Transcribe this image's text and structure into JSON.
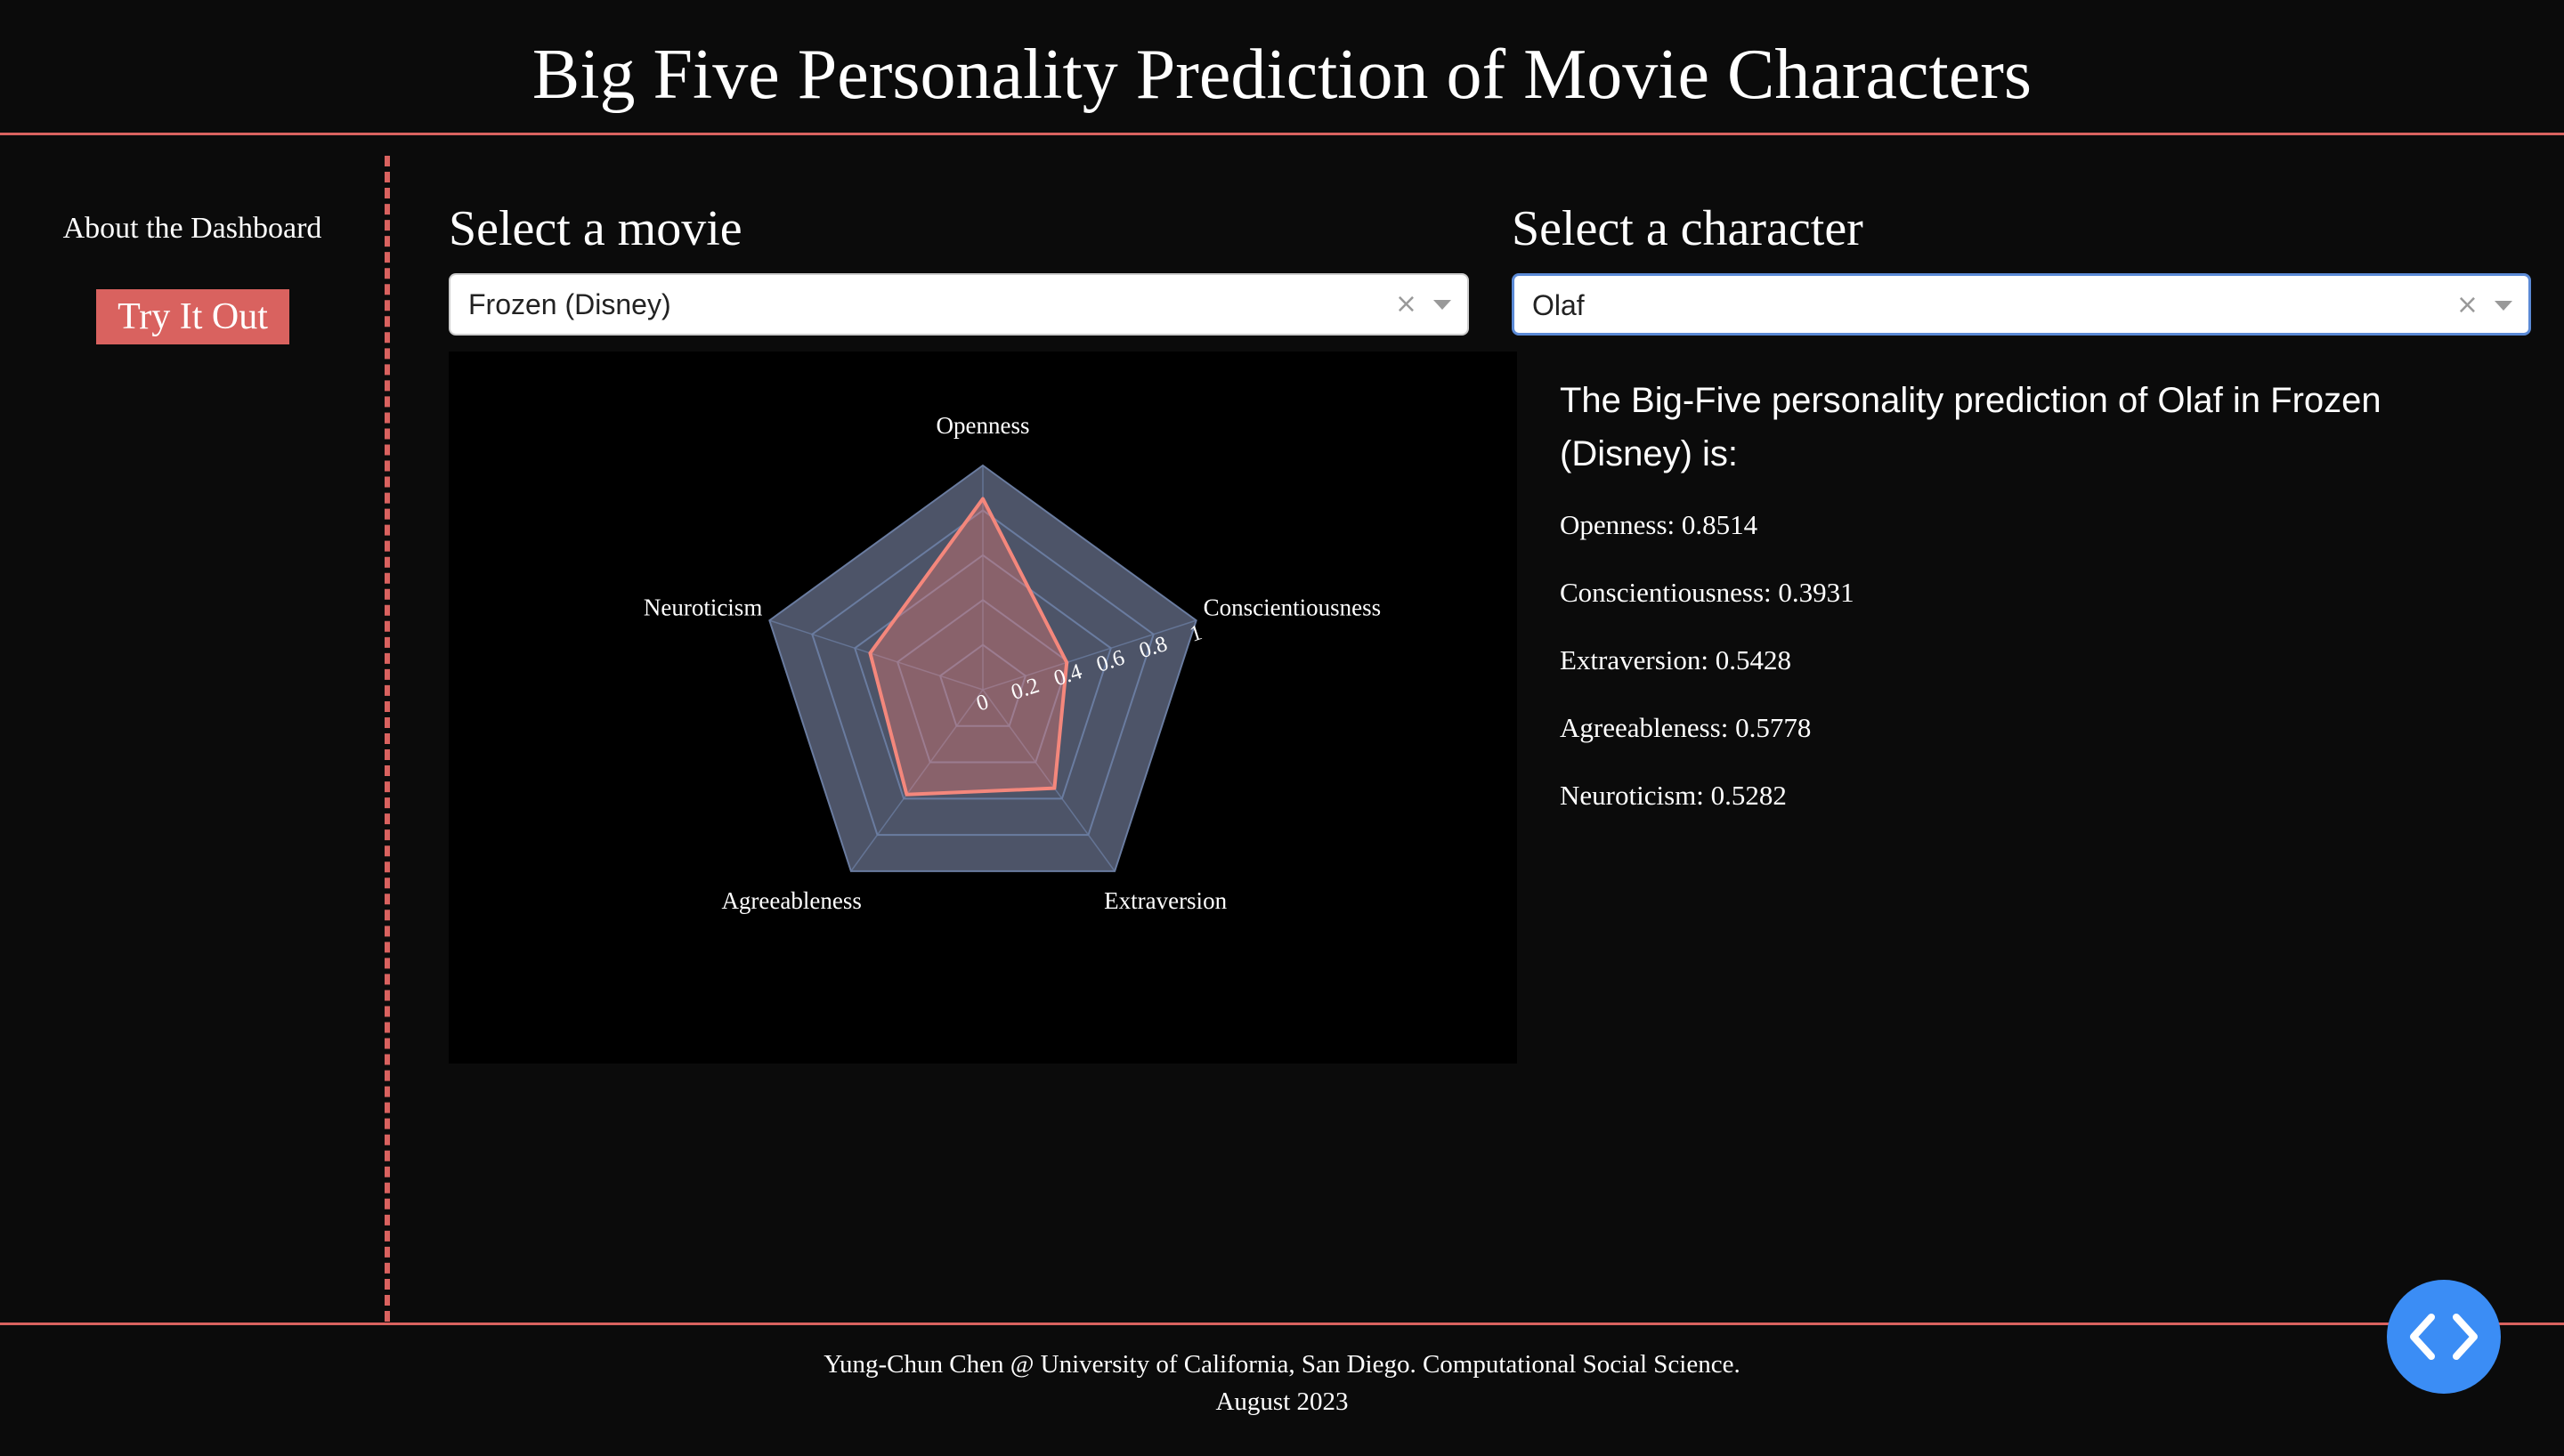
{
  "header": {
    "title": "Big Five Personality Prediction of Movie Characters"
  },
  "sidebar": {
    "about_label": "About the Dashboard",
    "try_label": "Try It Out"
  },
  "controls": {
    "movie_label": "Select a movie",
    "movie_value": "Frozen (Disney)",
    "character_label": "Select a character",
    "character_value": "Olaf",
    "clear_symbol": "×"
  },
  "chart_data": {
    "type": "radar",
    "categories": [
      "Openness",
      "Conscientiousness",
      "Extraversion",
      "Agreeableness",
      "Neuroticism"
    ],
    "series": [
      {
        "values": [
          0.8514,
          0.3931,
          0.5428,
          0.5778,
          0.5282
        ]
      }
    ],
    "radial_range": [
      0,
      1
    ],
    "radial_ticks": [
      "0",
      "0.2",
      "0.4",
      "0.6",
      "0.8",
      "1"
    ],
    "colors": {
      "fill": "#fa7f72",
      "line": "#f4877c",
      "polygon_bg": "#4d5468",
      "grid": "#6a7ca0",
      "background": "#000000"
    }
  },
  "prediction": {
    "heading": "The Big-Five personality prediction of Olaf in Frozen (Disney) is:",
    "lines": [
      "Openness: 0.8514",
      "Conscientiousness: 0.3931",
      "Extraversion: 0.5428",
      "Agreeableness: 0.5778",
      "Neuroticism: 0.5282"
    ]
  },
  "footer": {
    "credit": "Yung-Chun Chen @ University of California, San Diego. Computational Social Science.",
    "date": "August 2023"
  },
  "icons": {
    "code_toggle": "code-brackets-icon"
  },
  "colors": {
    "accent": "#d9625f",
    "background": "#0b0b0b",
    "fab": "#3b8df5",
    "focus_border": "#5b8ad6"
  }
}
